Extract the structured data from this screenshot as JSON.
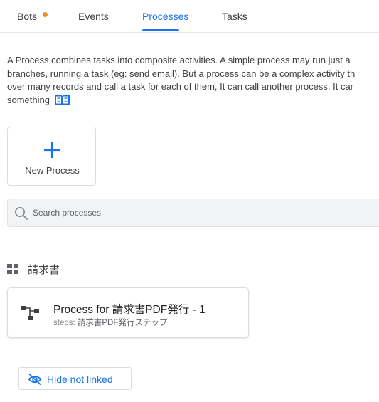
{
  "tabs": [
    {
      "label": "Bots",
      "has_dot": true
    },
    {
      "label": "Events"
    },
    {
      "label": "Processes",
      "active": true
    },
    {
      "label": "Tasks"
    }
  ],
  "description_lines": [
    "A Process combines tasks into composite activities. A simple process may run just a",
    "branches, running a task (eg: send email). But a process can be a complex activity th",
    "over many records and call a task for each of them, It can call another process, It car",
    "something"
  ],
  "new_process": {
    "label": "New Process",
    "icon": "plus-icon"
  },
  "search": {
    "placeholder": "Search processes",
    "icon": "search-icon"
  },
  "group": {
    "label": "請求書",
    "icon": "grid-icon"
  },
  "process": {
    "title": "Process for 請求書PDF発行 - 1",
    "steps_key": "steps:",
    "steps_value": "請求書PDF発行ステップ",
    "icon": "process-flow-icon"
  },
  "hide_button": {
    "label": "Hide not linked",
    "icon": "eye-off-icon"
  },
  "colors": {
    "accent": "#1a73e8",
    "dot": "#f28b22"
  }
}
